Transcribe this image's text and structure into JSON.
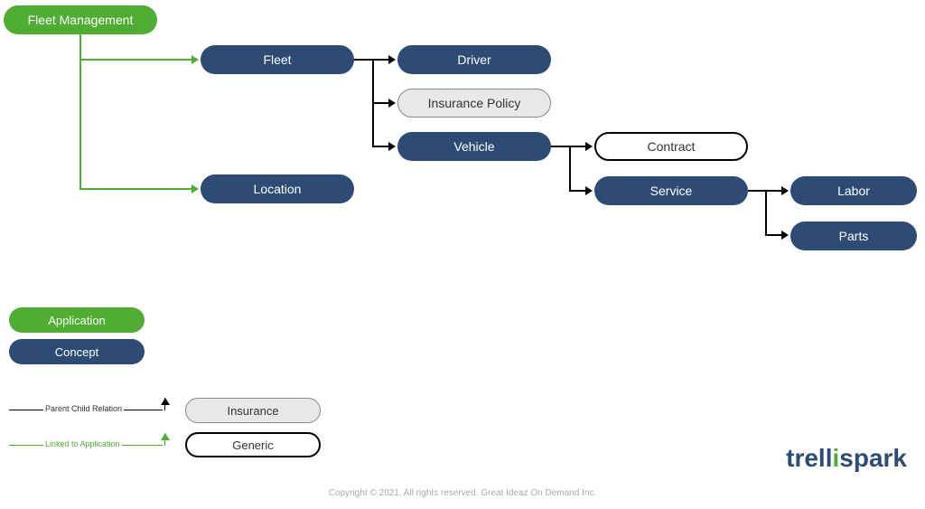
{
  "nodes": {
    "fleet_management": "Fleet Management",
    "fleet": "Fleet",
    "driver": "Driver",
    "insurance_policy": "Insurance Policy",
    "vehicle": "Vehicle",
    "contract": "Contract",
    "location": "Location",
    "service": "Service",
    "labor": "Labor",
    "parts": "Parts"
  },
  "legend": {
    "application": "Application",
    "concept": "Concept",
    "parent_child": "Parent Child Relation",
    "linked_to_app": "Linked to Application",
    "insurance": "Insurance",
    "generic": "Generic"
  },
  "logo": {
    "part1": "trell",
    "part2": "i",
    "part3": "spark"
  },
  "copyright": "Copyright © 2021. All rights reserved. Great Ideaz On Demand Inc."
}
